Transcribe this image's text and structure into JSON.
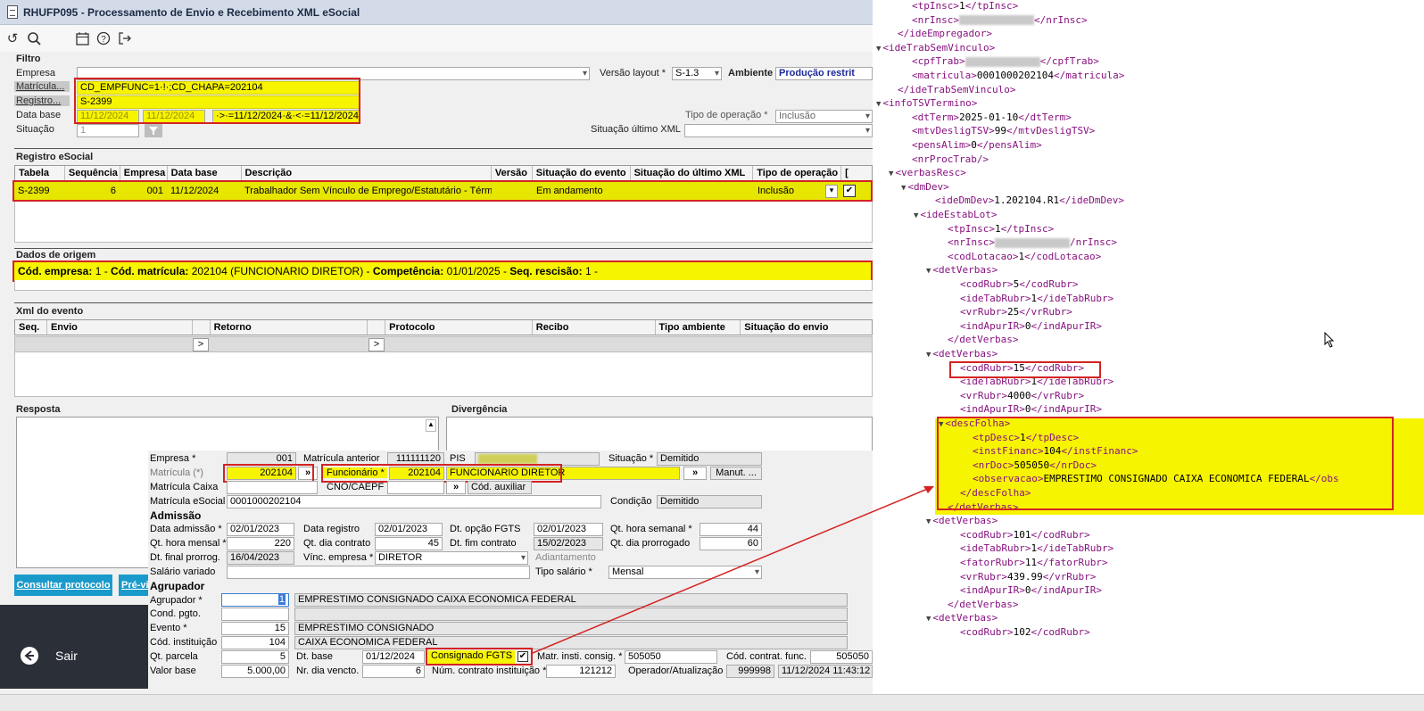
{
  "window": {
    "title": "RHUFP095 - Processamento de Envio e Recebimento XML eSocial"
  },
  "toolbar": {
    "icons": [
      "undo-icon",
      "search-icon",
      "calendar-icon",
      "help-icon",
      "exit-icon"
    ]
  },
  "filtro": {
    "section": "Filtro",
    "empresa_label": "Empresa",
    "empresa_value": "",
    "versao_label": "Versão layout *",
    "versao_value": "S-1.3",
    "ambiente_label": "Ambiente",
    "ambiente_value": "Produção restrit",
    "matricula_label": "Matrícula...",
    "matricula_value": "CD_EMPFUNC=1·!·;CD_CHAPA=202104",
    "registro_label": "Registro...",
    "registro_value": "S-2399",
    "database_label": "Data base",
    "database_from": "11/12/2024",
    "database_to": "11/12/2024",
    "database_expr": "·>·=11/12/2024·&·<·=11/12/2024",
    "tipo_op_label": "Tipo de operação *",
    "tipo_op_value": "Inclusão",
    "situacao_label": "Situação",
    "situacao_value": "1",
    "sit_ultimo_label": "Situação último XML",
    "sit_ultimo_value": ""
  },
  "registro": {
    "section": "Registro eSocial",
    "columns": [
      "Tabela",
      "Sequência",
      "Empresa",
      "Data base",
      "Descrição",
      "Versão",
      "Situação do evento",
      "Situação do último XML",
      "Tipo de operação",
      ""
    ],
    "row": {
      "tabela": "S-2399",
      "sequencia": "6",
      "empresa": "001",
      "database": "11/12/2024",
      "descricao": "Trabalhador Sem Vínculo de Emprego/Estatutário - Término",
      "versao": "",
      "situacao": "Em andamento",
      "sit_ultimo": "",
      "tipo_op": "Inclusão"
    }
  },
  "origem": {
    "section": "Dados de origem",
    "k1": "Cód. empresa:",
    "v1": " 1 - ",
    "k2": "Cód. matrícula:",
    "v2": " 202104 (FUNCIONARIO DIRETOR) - ",
    "k3": "Competência:",
    "v3": " 01/01/2025 - ",
    "k4": "Seq. rescisão:",
    "v4": " 1 -"
  },
  "xml_evento": {
    "section": "Xml do evento",
    "columns": [
      "Seq.",
      "Envio",
      "",
      "Retorno",
      "",
      "Protocolo",
      "Recibo",
      "Tipo ambiente",
      "Situação do envio"
    ]
  },
  "resposta": {
    "label": "Resposta"
  },
  "divergencia": {
    "label": "Divergência"
  },
  "buttons": {
    "consultar": "Consultar protocolo",
    "previa": "Pré-vi"
  },
  "sair": {
    "label": "Sair"
  },
  "funcionario": {
    "empresa_label": "Empresa *",
    "empresa": "001",
    "mat_ant_label": "Matrícula anterior",
    "mat_ant": "111111120",
    "pis_label": "PIS",
    "pis": "",
    "situacao_label": "Situação *",
    "situacao": "Demitido",
    "matricula_label": "Matrícula (*)",
    "matricula": "202104",
    "func_label": "Funcionário *",
    "func_code": "202104",
    "func_name": "FUNCIONARIO DIRETOR",
    "manut": "Manut. ...",
    "mat_caixa_label": "Matrícula Caixa",
    "cno_label": "CNO/CAEPF",
    "cod_aux": "Cód. auxiliar",
    "mat_esocial_label": "Matrícula eSocial",
    "mat_esocial": "0001000202104",
    "condicao_label": "Condição",
    "condicao": "Demitido",
    "admissao": "Admissão",
    "dt_adm_label": "Data admissão *",
    "dt_adm": "02/01/2023",
    "dt_reg_label": "Data registro",
    "dt_reg": "02/01/2023",
    "dt_fgts_label": "Dt. opção FGTS",
    "dt_fgts": "02/01/2023",
    "qt_hs_label": "Qt. hora semanal *",
    "qt_hs": "44",
    "qt_hm_label": "Qt. hora mensal *",
    "qt_hm": "220",
    "qt_dc_label": "Qt. dia contrato",
    "qt_dc": "45",
    "dt_fim_label": "Dt. fim contrato",
    "dt_fim": "15/02/2023",
    "qt_dp_label": "Qt. dia prorrogado",
    "qt_dp": "60",
    "dt_prorr_label": "Dt. final prorrog.",
    "dt_prorr": "16/04/2023",
    "vinc_label": "Vínc. empresa *",
    "vinc": "DIRETOR",
    "adiant_label": "Adiantamento",
    "sal_var_label": "Salário variado",
    "tipo_sal_label": "Tipo salário *",
    "tipo_sal": "Mensal",
    "agrupador_sec": "Agrupador",
    "agrup_label": "Agrupador *",
    "agrup": "1",
    "agrup_desc": "EMPRESTIMO CONSIGNADO CAIXA ECONOMICA FEDERAL",
    "cond_label": "Cond. pgto.",
    "evento_label": "Evento *",
    "evento": "15",
    "evento_desc": "EMPRESTIMO CONSIGNADO",
    "inst_label": "Cód. instituição",
    "inst": "104",
    "inst_desc": "CAIXA ECONOMICA FEDERAL",
    "qt_parc_label": "Qt. parcela",
    "qt_parc": "5",
    "dt_base_label": "Dt. base",
    "dt_base": "01/12/2024",
    "consignado_label": "Consignado FGTS",
    "matr_inst_label": "Matr. insti. consig. *",
    "matr_inst": "505050",
    "cod_contr_label": "Cód. contrat. func.",
    "cod_contr": "505050",
    "valor_label": "Valor base",
    "valor": "5.000,00",
    "nr_dia_label": "Nr. dia vencto.",
    "nr_dia": "6",
    "num_contr_label": "Núm. contrato instituição *",
    "num_contr": "121212",
    "operador_label": "Operador/Atualização",
    "operador": "999998",
    "atualizacao": "11/12/2024 11:43:12"
  },
  "xml_lines": [
    {
      "ind": 44,
      "arrow": false,
      "open": "<tpInsc>",
      "text": "1",
      "close": "</tpInsc>"
    },
    {
      "ind": 44,
      "arrow": false,
      "open": "<nrInsc>",
      "text": "",
      "blur": true,
      "close": "</nrInsc>"
    },
    {
      "ind": 28,
      "arrow": false,
      "open": "</ideEmpregador>",
      "text": "",
      "close": ""
    },
    {
      "ind": 16,
      "arrow": true,
      "open": "<ideTrabSemVinculo>",
      "text": "",
      "close": ""
    },
    {
      "ind": 44,
      "arrow": false,
      "open": "<cpfTrab>",
      "text": "",
      "blur": true,
      "close": "</cpfTrab>"
    },
    {
      "ind": 44,
      "arrow": false,
      "open": "<matricula>",
      "text": "0001000202104",
      "close": "</matricula>"
    },
    {
      "ind": 28,
      "arrow": false,
      "open": "</ideTrabSemVinculo>",
      "text": "",
      "close": ""
    },
    {
      "ind": 16,
      "arrow": true,
      "open": "<infoTSVTermino>",
      "text": "",
      "close": ""
    },
    {
      "ind": 44,
      "arrow": false,
      "open": "<dtTerm>",
      "text": "2025-01-10",
      "close": "</dtTerm>"
    },
    {
      "ind": 44,
      "arrow": false,
      "open": "<mtvDesligTSV>",
      "text": "99",
      "close": "</mtvDesligTSV>"
    },
    {
      "ind": 44,
      "arrow": false,
      "open": "<pensAlim>",
      "text": "0",
      "close": "</pensAlim>"
    },
    {
      "ind": 44,
      "arrow": false,
      "open": "<nrProcTrab/>",
      "text": "",
      "close": ""
    },
    {
      "ind": 30,
      "arrow": true,
      "open": "<verbasResc>",
      "text": "",
      "close": ""
    },
    {
      "ind": 44,
      "arrow": true,
      "open": "<dmDev>",
      "text": "",
      "close": ""
    },
    {
      "ind": 70,
      "arrow": false,
      "open": "<ideDmDev>",
      "text": "1.202104.R1",
      "close": "</ideDmDev>"
    },
    {
      "ind": 58,
      "arrow": true,
      "open": "<ideEstabLot>",
      "text": "",
      "close": ""
    },
    {
      "ind": 84,
      "arrow": false,
      "open": "<tpInsc>",
      "text": "1",
      "close": "</tpInsc>"
    },
    {
      "ind": 84,
      "arrow": false,
      "open": "<nrInsc>",
      "text": "",
      "blur": true,
      "close": "/nrInsc>"
    },
    {
      "ind": 84,
      "arrow": false,
      "open": "<codLotacao>",
      "text": "1",
      "close": "</codLotacao>"
    },
    {
      "ind": 72,
      "arrow": true,
      "open": "<detVerbas>",
      "text": "",
      "close": ""
    },
    {
      "ind": 98,
      "arrow": false,
      "open": "<codRubr>",
      "text": "5",
      "close": "</codRubr>"
    },
    {
      "ind": 98,
      "arrow": false,
      "open": "<ideTabRubr>",
      "text": "1",
      "close": "</ideTabRubr>"
    },
    {
      "ind": 98,
      "arrow": false,
      "open": "<vrRubr>",
      "text": "25",
      "close": "</vrRubr>"
    },
    {
      "ind": 98,
      "arrow": false,
      "open": "<indApurIR>",
      "text": "0",
      "close": "</indApurIR>"
    },
    {
      "ind": 84,
      "arrow": false,
      "open": "</detVerbas>",
      "text": "",
      "close": ""
    },
    {
      "ind": 72,
      "arrow": true,
      "open": "<detVerbas>",
      "text": "",
      "close": ""
    },
    {
      "ind": 98,
      "arrow": false,
      "open": "<codRubr>",
      "text": "15",
      "close": "</codRubr>"
    },
    {
      "ind": 98,
      "arrow": false,
      "open": "<ideTabRubr>",
      "text": "1",
      "close": "</ideTabRubr>"
    },
    {
      "ind": 98,
      "arrow": false,
      "open": "<vrRubr>",
      "text": "4000",
      "close": "</vrRubr>"
    },
    {
      "ind": 98,
      "arrow": false,
      "open": "<indApurIR>",
      "text": "0",
      "close": "</indApurIR>"
    },
    {
      "ind": 86,
      "arrow": true,
      "open": "<descFolha>",
      "text": "",
      "close": ""
    },
    {
      "ind": 112,
      "arrow": false,
      "open": "<tpDesc>",
      "text": "1",
      "close": "</tpDesc>"
    },
    {
      "ind": 112,
      "arrow": false,
      "open": "<instFinanc>",
      "text": "104",
      "close": "</instFinanc>"
    },
    {
      "ind": 112,
      "arrow": false,
      "open": "<nrDoc>",
      "text": "505050",
      "close": "</nrDoc>"
    },
    {
      "ind": 112,
      "arrow": false,
      "open": "<observacao>",
      "text": "EMPRESTIMO CONSIGNADO CAIXA ECONOMICA FEDERAL",
      "close": "</obs"
    },
    {
      "ind": 98,
      "arrow": false,
      "open": "</descFolha>",
      "text": "",
      "close": ""
    },
    {
      "ind": 84,
      "arrow": false,
      "open": "</detVerbas>",
      "text": "",
      "close": ""
    },
    {
      "ind": 72,
      "arrow": true,
      "open": "<detVerbas>",
      "text": "",
      "close": ""
    },
    {
      "ind": 98,
      "arrow": false,
      "open": "<codRubr>",
      "text": "101",
      "close": "</codRubr>"
    },
    {
      "ind": 98,
      "arrow": false,
      "open": "<ideTabRubr>",
      "text": "1",
      "close": "</ideTabRubr>"
    },
    {
      "ind": 98,
      "arrow": false,
      "open": "<fatorRubr>",
      "text": "11",
      "close": "</fatorRubr>"
    },
    {
      "ind": 98,
      "arrow": false,
      "open": "<vrRubr>",
      "text": "439.99",
      "close": "</vrRubr>"
    },
    {
      "ind": 98,
      "arrow": false,
      "open": "<indApurIR>",
      "text": "0",
      "close": "</indApurIR>"
    },
    {
      "ind": 84,
      "arrow": false,
      "open": "</detVerbas>",
      "text": "",
      "close": ""
    },
    {
      "ind": 72,
      "arrow": true,
      "open": "<detVerbas>",
      "text": "",
      "close": ""
    },
    {
      "ind": 98,
      "arrow": false,
      "open": "<codRubr>",
      "text": "102",
      "close": "</codRubr>"
    }
  ],
  "colors": {
    "highlight": "#f7f400",
    "red": "#d42323",
    "blue_btn": "#1a9acb",
    "tag": "#881280"
  }
}
